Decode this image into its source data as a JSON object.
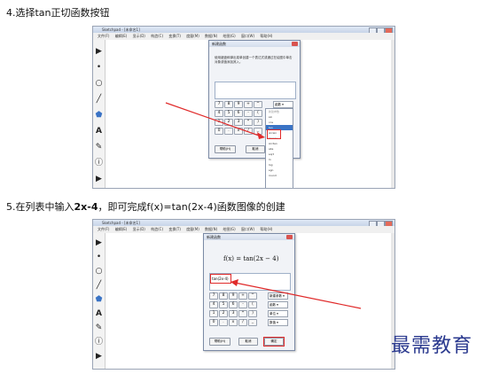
{
  "step4": {
    "text": "4.选择tan正切函数按钮"
  },
  "step5": {
    "prefix": "5.在列表中输入",
    "bold": "2x-4",
    "suffix": "，即可完成f(x)=tan(2x-4)函数图像的创建"
  },
  "app": {
    "title": "Sketchpad - [未命名1]",
    "menu": [
      "文件(F)",
      "编辑(E)",
      "显示(D)",
      "构造(C)",
      "变换(T)",
      "度量(M)",
      "数据(N)",
      "绘图(G)",
      "窗口(W)",
      "帮助(H)"
    ]
  },
  "tools": {
    "arrow": "▶",
    "point": "•",
    "circle": "○",
    "line": "╱",
    "polygon": "⬟",
    "text": "A",
    "marker": "✎",
    "info": "ⓘ",
    "custom": "▶"
  },
  "dialog1": {
    "title": "新建函数",
    "instruction": "使用键盘和弹出菜单创建一个表达式或通过在绘图中单击对象或值添加其入。",
    "keys": [
      "7",
      "8",
      "9",
      "+",
      "^",
      "4",
      "5",
      "6",
      "-",
      "(",
      "1",
      "2",
      "3",
      "*",
      ")",
      "0",
      ".",
      "x",
      "/",
      "_"
    ],
    "func_select": "函数 ▾",
    "buttons": {
      "help": "帮助(H)",
      "cancel": "取消",
      "ok": "确定"
    },
    "dropdown_items": [
      "sin",
      "cos",
      "tan",
      "Arcsin",
      "Arccos",
      "Arctan",
      "abs",
      "sqrt",
      "ln",
      "log",
      "sgn",
      "round",
      "trunc"
    ],
    "dropdown_header": "新建参数"
  },
  "dialog2": {
    "title": "新建函数",
    "formula": "f(x) = tan(2x − 4)",
    "entry": "tan(2x-4)",
    "keys": [
      "7",
      "8",
      "9",
      "+",
      "^",
      "4",
      "5",
      "6",
      "-",
      "(",
      "1",
      "2",
      "3",
      "*",
      ")",
      "0",
      ".",
      "x",
      "/",
      "_"
    ],
    "selects": [
      "新建参数 ▾",
      "函数 ▾",
      "单位 ▾",
      "数值 ▾"
    ],
    "buttons": {
      "help": "帮助(H)",
      "cancel": "取消",
      "ok": "确定"
    }
  },
  "watermark": "最需教育",
  "colors": {
    "annotation": "#e02a2a",
    "selection": "#3a73c5",
    "watermark": "#2b3a8f"
  }
}
